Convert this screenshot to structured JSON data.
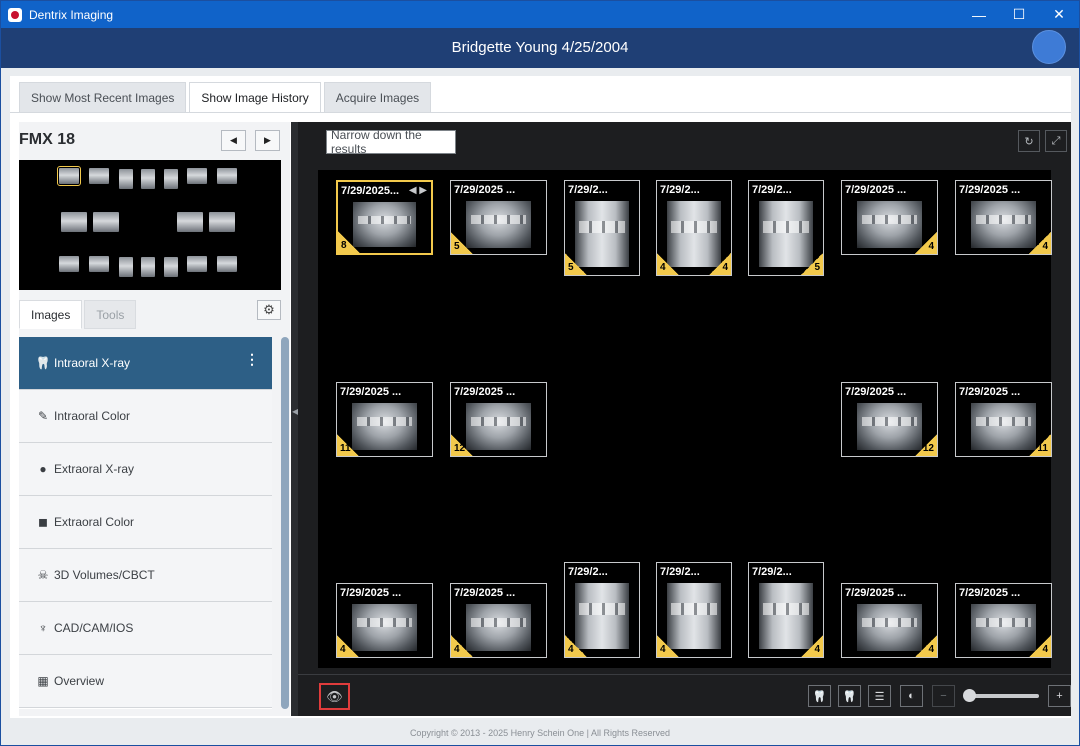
{
  "window": {
    "title": "Dentrix Imaging",
    "minimize": "—",
    "maximize": "☐",
    "close": "✕"
  },
  "patient": {
    "name_date": "Bridgette Young 4/25/2004"
  },
  "tabs": [
    {
      "label": "Show Most Recent Images"
    },
    {
      "label": "Show Image History"
    },
    {
      "label": "Acquire Images"
    }
  ],
  "left": {
    "fmx_title": "FMX 18",
    "prev_glyph": "◀",
    "next_glyph": "▶",
    "subtabs": [
      {
        "label": "Images"
      },
      {
        "label": "Tools"
      }
    ],
    "gear_glyph": "⚙",
    "categories": [
      {
        "label": "Intraoral X-ray",
        "icon": "tooth-icon",
        "glyph": "🦷"
      },
      {
        "label": "Intraoral Color",
        "icon": "intraoral-camera-icon",
        "glyph": "✎"
      },
      {
        "label": "Extraoral X-ray",
        "icon": "head-profile-icon",
        "glyph": "●"
      },
      {
        "label": "Extraoral Color",
        "icon": "camera-icon",
        "glyph": "◼"
      },
      {
        "label": "3D Volumes/CBCT",
        "icon": "skull-icon",
        "glyph": "☠"
      },
      {
        "label": "CAD/CAM/IOS",
        "icon": "implant-icon",
        "glyph": "♆"
      },
      {
        "label": "Overview",
        "icon": "grid-icon",
        "glyph": "▦"
      }
    ],
    "kebab": "⋮"
  },
  "viewer": {
    "filter_placeholder": "Narrow down the results",
    "refresh_glyph": "↻",
    "expand_glyph": "⤢",
    "cards": [
      {
        "title": "7/29/2025...",
        "bl": "8",
        "br": ""
      },
      {
        "title": "7/29/2025 ...",
        "bl": "5",
        "br": ""
      },
      {
        "title": "7/29/2...",
        "bl": "5",
        "br": ""
      },
      {
        "title": "7/29/2...",
        "bl": "4",
        "br": "4"
      },
      {
        "title": "7/29/2...",
        "bl": "",
        "br": "5"
      },
      {
        "title": "7/29/2025 ...",
        "bl": "",
        "br": "4"
      },
      {
        "title": "7/29/2025 ...",
        "bl": "",
        "br": "4"
      },
      {
        "title": "7/29/2025 ...",
        "bl": "11",
        "br": ""
      },
      {
        "title": "7/29/2025 ...",
        "bl": "12",
        "br": ""
      },
      {
        "title": "7/29/2025 ...",
        "bl": "",
        "br": "12"
      },
      {
        "title": "7/29/2025 ...",
        "bl": "",
        "br": "11"
      },
      {
        "title": "7/29/2025 ...",
        "bl": "4",
        "br": ""
      },
      {
        "title": "7/29/2025 ...",
        "bl": "4",
        "br": ""
      },
      {
        "title": "7/29/2...",
        "bl": "4",
        "br": ""
      },
      {
        "title": "7/29/2...",
        "bl": "4",
        "br": ""
      },
      {
        "title": "7/29/2...",
        "bl": "",
        "br": "4"
      },
      {
        "title": "7/29/2025 ...",
        "bl": "",
        "br": "4"
      },
      {
        "title": "7/29/2025 ...",
        "bl": "",
        "br": "4"
      }
    ],
    "card_nav": "◀ ▶"
  },
  "toolbar": {
    "eye_glyph": "👁",
    "tooth_glyph": "🦷",
    "tooth_yellow_glyph": "🦷",
    "adjust_glyph": "☰",
    "contrast_glyph": "◐",
    "minus_glyph": "−",
    "plus_glyph": "+"
  },
  "footer": {
    "copyright": "Copyright © 2013 - 2025 Henry Schein One | All Rights Reserved"
  }
}
